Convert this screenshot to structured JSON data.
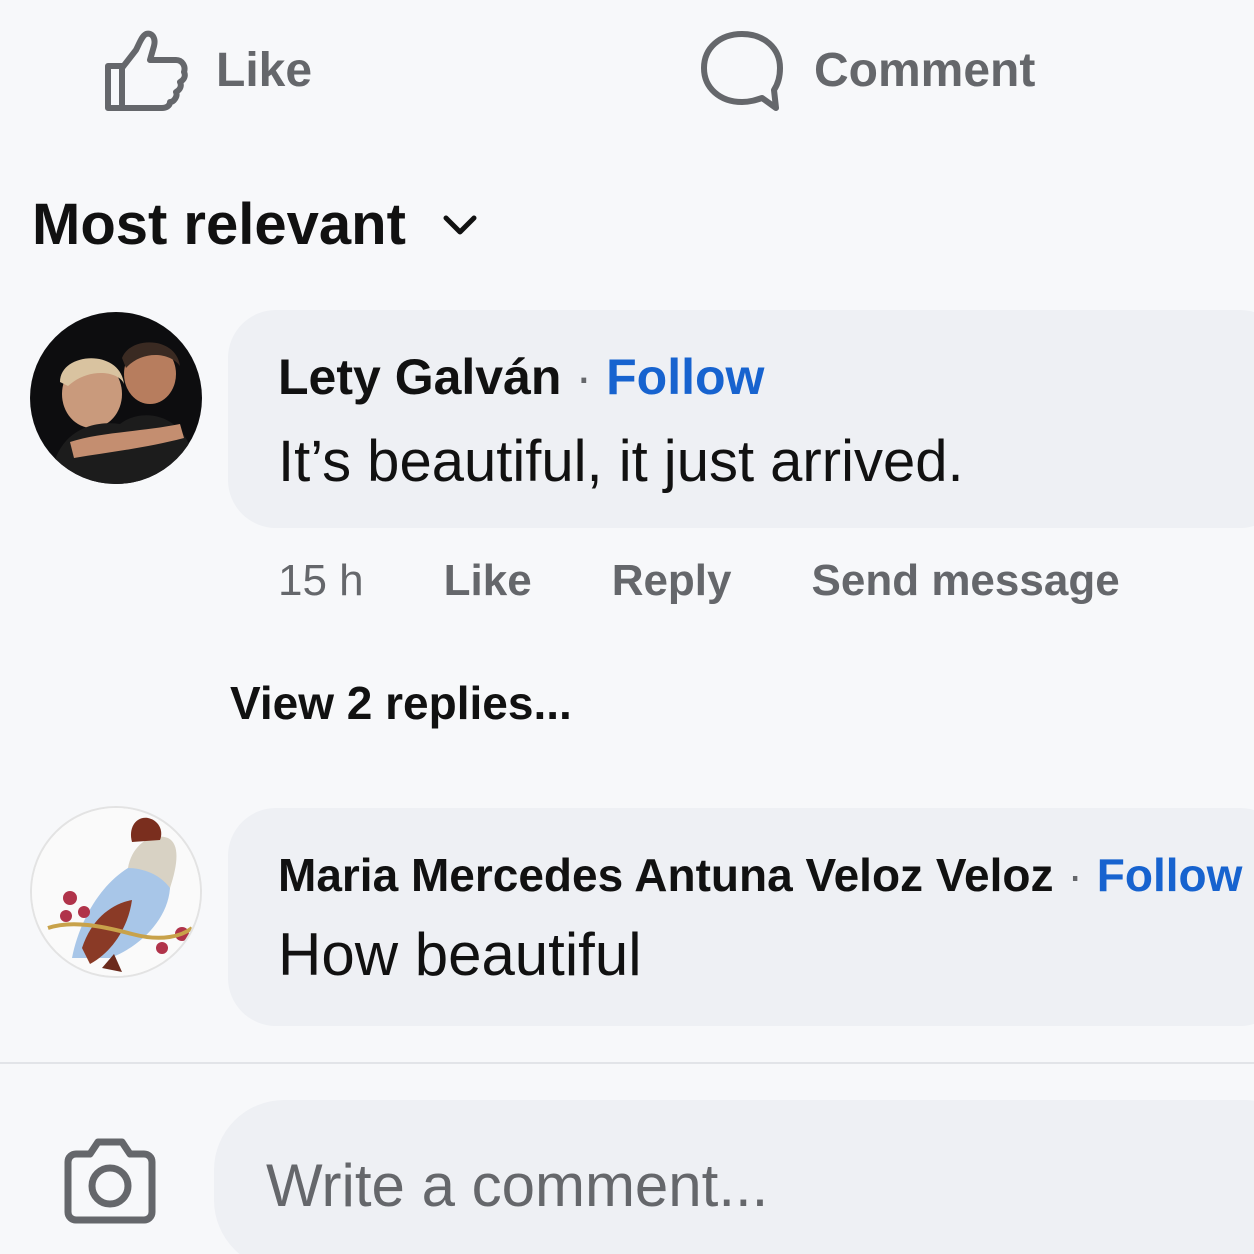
{
  "actions": {
    "like_label": "Like",
    "comment_label": "Comment"
  },
  "sort": {
    "label": "Most relevant"
  },
  "comments": [
    {
      "author": "Lety Galván",
      "separator": "·",
      "follow_label": "Follow",
      "text": "It’s beautiful, it just arrived.",
      "time": "15 h",
      "like_label": "Like",
      "reply_label": "Reply",
      "send_message_label": "Send message",
      "view_replies": "View 2 replies..."
    },
    {
      "author": "Maria Mercedes Antuna Veloz Veloz",
      "separator": "·",
      "follow_label": "Follow",
      "text": "How beautiful"
    }
  ],
  "composer": {
    "placeholder": "Write a comment..."
  },
  "colors": {
    "accent": "#1763cf",
    "secondary_text": "#65676b",
    "bubble": "#eef0f4"
  }
}
